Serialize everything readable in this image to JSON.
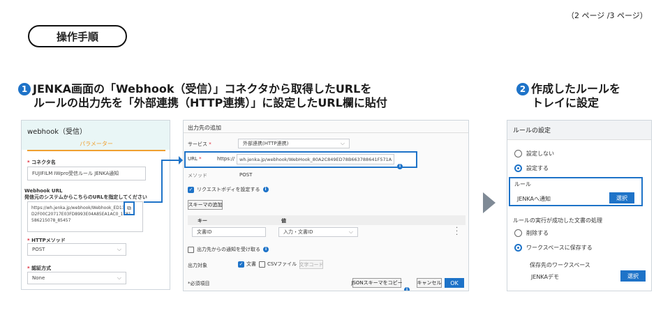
{
  "page_indicator": "（2 ページ /3 ページ）",
  "section_title": "操作手順",
  "step1": {
    "num": "1",
    "line1": "JENKA画面の「Webhook（受信）」コネクタから取得したURLを",
    "line2": "ルールの出力先を「外部連携（HTTP連携）」に設定したURL欄に貼付"
  },
  "step2": {
    "num": "2",
    "line1": "作成したルールを",
    "line2": "トレイに設定"
  },
  "webhook_panel": {
    "title": "webhook（受信）",
    "tab": "パラメーター",
    "connector_label": "コネクタ名",
    "connector_value": "FUJIFILM IWpro受信ルール JENKA通知",
    "url_label_1": "Webhook URL",
    "url_label_2": "発信元のシステムからこちらのURLを指定してください",
    "url_value_1": "https://wh.jenka.jp/webhook/Webhook_ED13",
    "url_value_2": "D2F00C20717E03FD8993E04A85EA1AC0_1781",
    "url_value_3": "586215078_85457",
    "method_label": "HTTPメソッド",
    "method_value": "POST",
    "auth_label": "認証方式",
    "auth_value": "None"
  },
  "output_panel": {
    "title": "出力先の追加",
    "service_label": "サービス",
    "service_value": "外部連携(HTTP連携)",
    "url_label": "URL",
    "url_prefix": "https://",
    "url_value": "wh.jenka.jp/webhook/WebHook_80A2C849ED78B663788641F571A",
    "method_label": "メソッド",
    "method_value": "POST",
    "request_body_label": "リクエストボディを設定する",
    "add_schema_button": "スキーマの追加",
    "key_header": "キー",
    "value_header": "値",
    "key_value": "文書ID",
    "value_value": "入力・文書ID",
    "accept_notify_label": "出力先からの通知を受け取る",
    "output_target_label": "出力対象",
    "doc_label": "文書",
    "csv_label": "CSVファイル",
    "charcode_button": "文字コード",
    "required_note": "*必須項目",
    "copy_json_button": "JSONスキーマをコピー",
    "cancel_button": "キャンセル",
    "ok_button": "OK"
  },
  "rule_panel": {
    "title": "ルールの設定",
    "option_none": "設定しない",
    "option_set": "設定する",
    "rule_label": "ルール",
    "rule_value": "JENKAへ通知",
    "select_button": "選択",
    "success_label": "ルールの実行が成功した文書の処理",
    "option_delete": "削除する",
    "option_save": "ワークスペースに保存する",
    "workspace_label": "保存先のワークスペース",
    "workspace_value": "JENKAデモ",
    "select_button_2": "選択"
  },
  "colors": {
    "accent": "#1e73c8",
    "panel_header_teal": "#e9f6f6",
    "orange": "#f0a030"
  }
}
